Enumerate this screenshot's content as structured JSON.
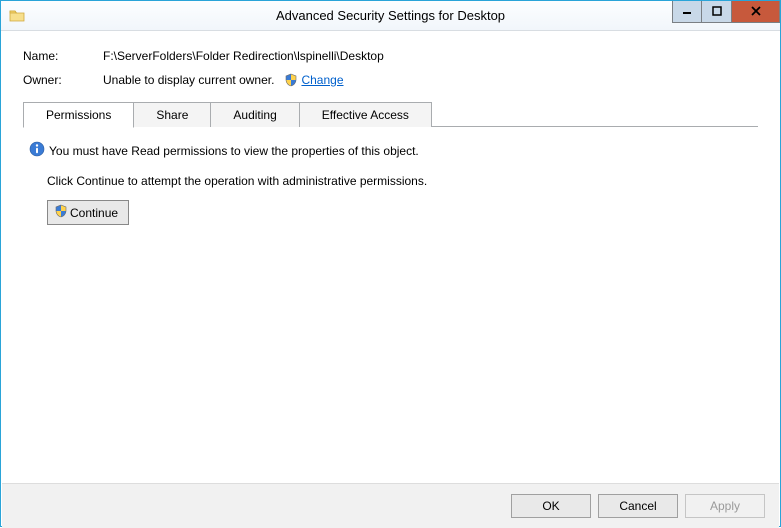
{
  "window": {
    "title": "Advanced Security Settings for Desktop"
  },
  "details": {
    "name_label": "Name:",
    "name_value": "F:\\ServerFolders\\Folder Redirection\\lspinelli\\Desktop",
    "owner_label": "Owner:",
    "owner_value": "Unable to display current owner.",
    "change_link": "Change"
  },
  "tabs": {
    "items": [
      {
        "label": "Permissions"
      },
      {
        "label": "Share"
      },
      {
        "label": "Auditing"
      },
      {
        "label": "Effective Access"
      }
    ]
  },
  "body": {
    "info_text": "You must have Read permissions to view the properties of this object.",
    "instruction_text": "Click Continue to attempt the operation with administrative permissions.",
    "continue_label": "Continue"
  },
  "footer": {
    "ok": "OK",
    "cancel": "Cancel",
    "apply": "Apply"
  }
}
